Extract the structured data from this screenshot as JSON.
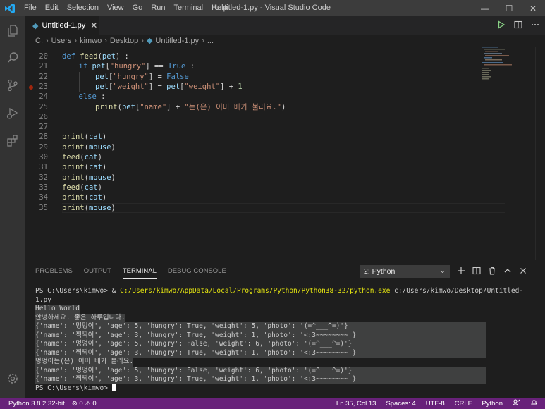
{
  "titlebar": {
    "menu": [
      "File",
      "Edit",
      "Selection",
      "View",
      "Go",
      "Run",
      "Terminal",
      "Help"
    ],
    "title": "Untitled-1.py - Visual Studio Code",
    "minimize": "—",
    "maximize": "☐",
    "close": "✕"
  },
  "tab": {
    "icon_glyph": "◆",
    "label": "Untitled-1.py",
    "close": "✕"
  },
  "breadcrumb": [
    "C:",
    "Users",
    "kimwo",
    "Desktop",
    "Untitled-1.py",
    "..."
  ],
  "editor": {
    "lines": [
      {
        "n": "20",
        "indent": 0,
        "tokens": [
          [
            "kw",
            "def "
          ],
          [
            "fn",
            "feed"
          ],
          [
            "op",
            "("
          ],
          [
            "var",
            "pet"
          ],
          [
            "op",
            ") :"
          ]
        ]
      },
      {
        "n": "21",
        "indent": 1,
        "tokens": [
          [
            "kw",
            "if "
          ],
          [
            "var",
            "pet"
          ],
          [
            "op",
            "["
          ],
          [
            "str",
            "\"hungry\""
          ],
          [
            "op",
            "] == "
          ],
          [
            "kw",
            "True"
          ],
          [
            "op",
            " :"
          ]
        ]
      },
      {
        "n": "22",
        "indent": 2,
        "tokens": [
          [
            "var",
            "pet"
          ],
          [
            "op",
            "["
          ],
          [
            "str",
            "\"hungry\""
          ],
          [
            "op",
            "] = "
          ],
          [
            "kw",
            "False"
          ]
        ]
      },
      {
        "n": "23",
        "indent": 2,
        "breakpoint": true,
        "tokens": [
          [
            "var",
            "pet"
          ],
          [
            "op",
            "["
          ],
          [
            "str",
            "\"weight\""
          ],
          [
            "op",
            "] = "
          ],
          [
            "var",
            "pet"
          ],
          [
            "op",
            "["
          ],
          [
            "str",
            "\"weight\""
          ],
          [
            "op",
            "] + "
          ],
          [
            "num",
            "1"
          ]
        ]
      },
      {
        "n": "24",
        "indent": 1,
        "tokens": [
          [
            "kw",
            "else"
          ],
          [
            "op",
            " :"
          ]
        ]
      },
      {
        "n": "25",
        "indent": 2,
        "tokens": [
          [
            "fn",
            "print"
          ],
          [
            "op",
            "("
          ],
          [
            "var",
            "pet"
          ],
          [
            "op",
            "["
          ],
          [
            "str",
            "\"name\""
          ],
          [
            "op",
            "] + "
          ],
          [
            "str",
            "\"는(은) 이미 배가 불러요.\""
          ],
          [
            "op",
            ")"
          ]
        ]
      },
      {
        "n": "26",
        "indent": 0,
        "tokens": []
      },
      {
        "n": "27",
        "indent": 0,
        "tokens": []
      },
      {
        "n": "28",
        "indent": 0,
        "tokens": [
          [
            "fn",
            "print"
          ],
          [
            "op",
            "("
          ],
          [
            "var",
            "cat"
          ],
          [
            "op",
            ")"
          ]
        ]
      },
      {
        "n": "29",
        "indent": 0,
        "tokens": [
          [
            "fn",
            "print"
          ],
          [
            "op",
            "("
          ],
          [
            "var",
            "mouse"
          ],
          [
            "op",
            ")"
          ]
        ]
      },
      {
        "n": "30",
        "indent": 0,
        "tokens": [
          [
            "fn",
            "feed"
          ],
          [
            "op",
            "("
          ],
          [
            "var",
            "cat"
          ],
          [
            "op",
            ")"
          ]
        ]
      },
      {
        "n": "31",
        "indent": 0,
        "tokens": [
          [
            "fn",
            "print"
          ],
          [
            "op",
            "("
          ],
          [
            "var",
            "cat"
          ],
          [
            "op",
            ")"
          ]
        ]
      },
      {
        "n": "32",
        "indent": 0,
        "tokens": [
          [
            "fn",
            "print"
          ],
          [
            "op",
            "("
          ],
          [
            "var",
            "mouse"
          ],
          [
            "op",
            ")"
          ]
        ]
      },
      {
        "n": "33",
        "indent": 0,
        "tokens": [
          [
            "fn",
            "feed"
          ],
          [
            "op",
            "("
          ],
          [
            "var",
            "cat"
          ],
          [
            "op",
            ")"
          ]
        ]
      },
      {
        "n": "34",
        "indent": 0,
        "tokens": [
          [
            "fn",
            "print"
          ],
          [
            "op",
            "("
          ],
          [
            "var",
            "cat"
          ],
          [
            "op",
            ")"
          ]
        ]
      },
      {
        "n": "35",
        "indent": 0,
        "current": true,
        "tokens": [
          [
            "fn",
            "print"
          ],
          [
            "op",
            "("
          ],
          [
            "var",
            "mouse"
          ],
          [
            "op",
            ")"
          ]
        ]
      }
    ]
  },
  "panel": {
    "tabs": [
      "PROBLEMS",
      "OUTPUT",
      "TERMINAL",
      "DEBUG CONSOLE"
    ],
    "active_tab": "TERMINAL",
    "terminal_select": "2: Python",
    "chevron": "⌄"
  },
  "terminal": {
    "lines": [
      {
        "prefix": "PS C:\\Users\\kimwo> & ",
        "yellow": "C:/Users/kimwo/AppData/Local/Programs/Python/Python38-32/python.exe",
        "suffix": " c:/Users/kimwo/Desktop/Untitled-",
        "sel": false
      },
      {
        "text": "1.py",
        "sel": false
      },
      {
        "text": "Hello World",
        "sel": true
      },
      {
        "text": "안녕하세요. 좋은 하루입니다.",
        "sel": true
      },
      {
        "text": "{'name': '멍멍이', 'age': 5, 'hungry': True, 'weight': 5, 'photo': '(=^___^=)'}",
        "sel": true
      },
      {
        "text": "{'name': '찍찍이', 'age': 3, 'hungry': True, 'weight': 1, 'photo': '<:3~~~~~~~~'}",
        "sel": true
      },
      {
        "text": "{'name': '멍멍이', 'age': 5, 'hungry': False, 'weight': 6, 'photo': '(=^___^=)'}",
        "sel": true
      },
      {
        "text": "{'name': '찍찍이', 'age': 3, 'hungry': True, 'weight': 1, 'photo': '<:3~~~~~~~~'}",
        "sel": true
      },
      {
        "text": "멍멍이는(은) 이미 배가 불러요.",
        "sel": true
      },
      {
        "text": "{'name': '멍멍이', 'age': 5, 'hungry': False, 'weight': 6, 'photo': '(=^___^=)'}",
        "sel": true
      },
      {
        "text": "{'name': '찍찍이', 'age': 3, 'hungry': True, 'weight': 1, 'photo': '<:3~~~~~~~~'}",
        "sel": true
      },
      {
        "text": "PS C:\\Users\\kimwo> ",
        "sel": false,
        "cursor": true
      }
    ]
  },
  "statusbar": {
    "python": "Python 3.8.2 32-bit",
    "errors": "⊗ 0",
    "warnings": "⚠ 0",
    "position": "Ln 35, Col 13",
    "spaces": "Spaces: 4",
    "encoding": "UTF-8",
    "eol": "CRLF",
    "language": "Python"
  },
  "colors": {
    "accent_status": "#68217a",
    "vscode_blue": "#23a9f2",
    "run_green": "#89d185"
  }
}
